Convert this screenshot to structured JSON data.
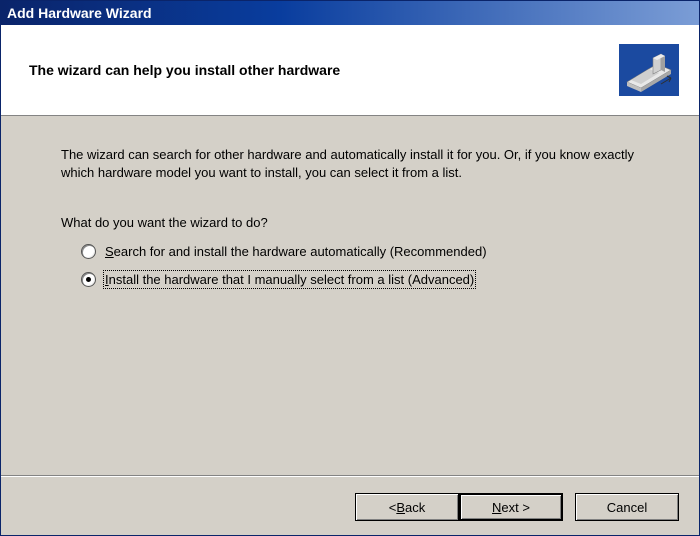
{
  "title": "Add Hardware Wizard",
  "header": {
    "title": "The wizard can help you install other hardware"
  },
  "content": {
    "instructions": "The wizard can search for other hardware and automatically install it for you. Or, if you know exactly which hardware model you want to install, you can select it from a list.",
    "question": "What do you want the wizard to do?",
    "options": [
      {
        "hotkey": "S",
        "rest": "earch for and install the hardware automatically (Recommended)",
        "selected": false
      },
      {
        "hotkey": "I",
        "rest": "nstall the hardware that I manually select from a list (Advanced)",
        "selected": true
      }
    ]
  },
  "buttons": {
    "back_prefix": "< ",
    "back_hotkey": "B",
    "back_rest": "ack",
    "next_hotkey": "N",
    "next_rest": "ext >",
    "cancel": "Cancel"
  }
}
